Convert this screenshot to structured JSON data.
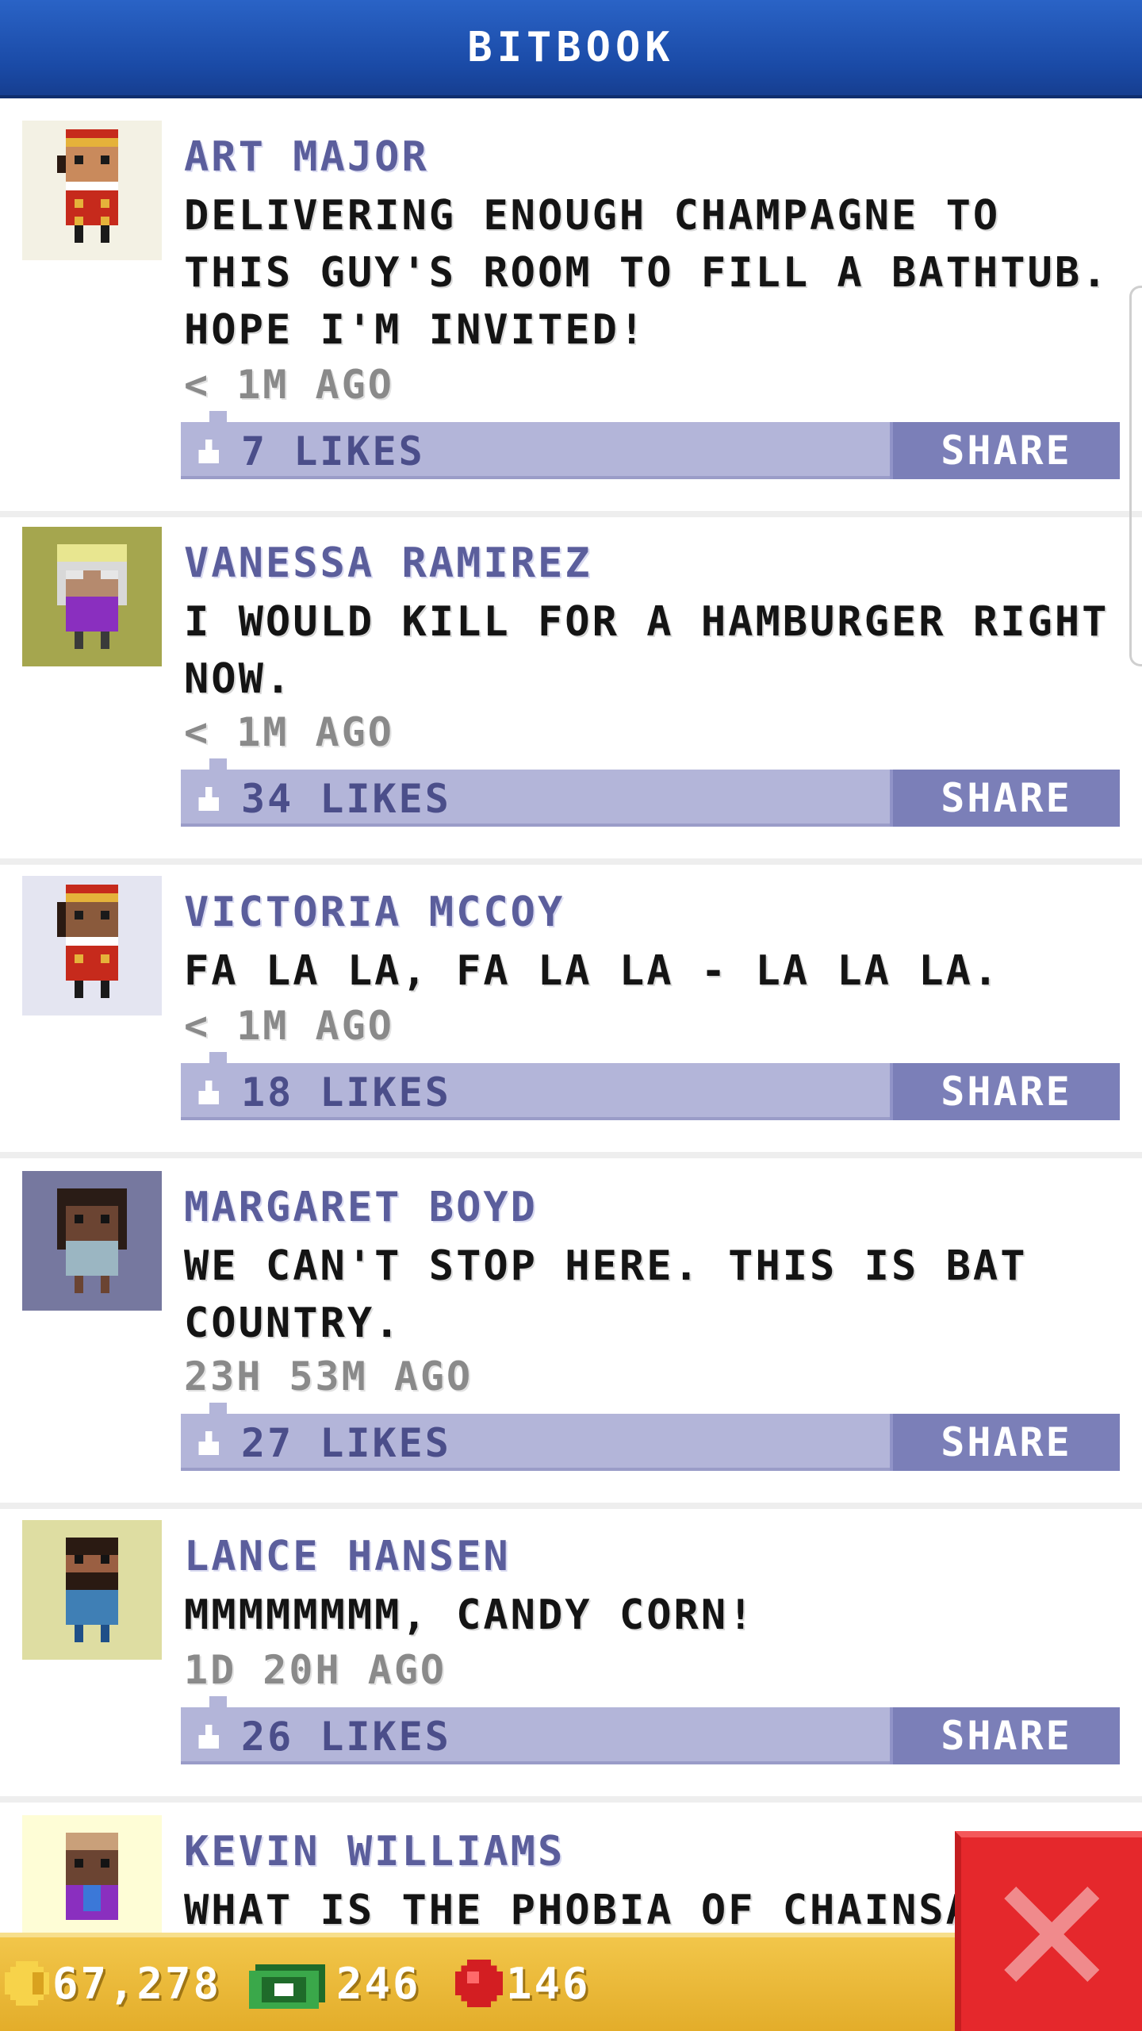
{
  "header": {
    "title": "BITBOOK"
  },
  "posts": [
    {
      "author": "ART MAJOR",
      "message": "DELIVERING ENOUGH CHAMPAGNE TO THIS GUY'S ROOM TO FILL A BATHTUB. HOPE I'M INVITED!",
      "time": "< 1M AGO",
      "likes": "7 LIKES",
      "share": "SHARE",
      "avatar_bg": "#f3f1e4"
    },
    {
      "author": "VANESSA RAMIREZ",
      "message": "I WOULD KILL FOR A HAMBURGER RIGHT NOW.",
      "time": "< 1M AGO",
      "likes": "34 LIKES",
      "share": "SHARE",
      "avatar_bg": "#a5a64e"
    },
    {
      "author": "VICTORIA MCCOY",
      "message": "FA LA LA, FA LA LA - LA LA LA.",
      "time": "< 1M AGO",
      "likes": "18 LIKES",
      "share": "SHARE",
      "avatar_bg": "#e4e5f1"
    },
    {
      "author": "MARGARET BOYD",
      "message": "WE CAN'T STOP HERE. THIS IS BAT COUNTRY.",
      "time": "23H 53M AGO",
      "likes": "27 LIKES",
      "share": "SHARE",
      "avatar_bg": "#76789f"
    },
    {
      "author": "LANCE HANSEN",
      "message": "MMMMMMMM, CANDY CORN!",
      "time": "1D 20H AGO",
      "likes": "26 LIKES",
      "share": "SHARE",
      "avatar_bg": "#dedda2"
    },
    {
      "author": "KEVIN WILLIAMS",
      "message": "WHAT IS THE PHOBIA OF CHAINSA",
      "time": "",
      "likes": "",
      "share": "",
      "avatar_bg": "#fefdd6"
    }
  ],
  "bottom_bar": {
    "coins": "67,278",
    "bux": "246",
    "gems": "146"
  },
  "icons": {
    "like": "thumbs-up-icon",
    "coin": "coin-icon",
    "bux": "bux-icon",
    "gem": "gem-icon",
    "close": "close-icon"
  },
  "colors": {
    "header": "#1f54b8",
    "author": "#5b5e9c",
    "like_bar": "#b3b5d9",
    "share_button": "#7b7fb8",
    "bottom_bar": "#e9b634",
    "close_button": "#e5282c"
  }
}
